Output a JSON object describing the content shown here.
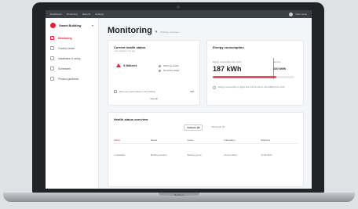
{
  "topbar": {
    "items": [
      "Dashboard",
      "Monitoring",
      "Reports",
      "Settings"
    ],
    "user_label": "User name"
  },
  "sidebar": {
    "brand_name": "Smart Building",
    "items": [
      {
        "label": "Monitoring",
        "active": true
      },
      {
        "label": "Control center",
        "active": false
      },
      {
        "label": "Installation & setup",
        "active": false
      },
      {
        "label": "Schedules",
        "active": false
      },
      {
        "label": "Product guidance",
        "active": false
      }
    ]
  },
  "main": {
    "title": "Monitoring",
    "title_sub": "Building overview",
    "health_card": {
      "title": "Current health status",
      "subtitle": "Last updated 5 min ago",
      "status": "3 failures",
      "legend": [
        "Warning states",
        "No active faults"
      ],
      "note": "Show only active failures in this building",
      "count": "3/28",
      "link": "View all"
    },
    "energy_card": {
      "title": "Energy consumption",
      "label": "Energy consumption this month",
      "value": "187 kWh",
      "limit_label": "Set limit",
      "limit_value": "140 kWh",
      "fill": 0.78,
      "note": "Energy consumption is higher than the limit set for this building this month"
    },
    "events_card": {
      "title": "Health status overview",
      "tabs": [
        "Failures (3)",
        "Warnings (5)"
      ],
      "columns": [
        "Status",
        "Device",
        "Group",
        "Information",
        "Date/time"
      ],
      "row": [
        "Unavailable",
        "Building actuator",
        "Building group",
        "Device offline",
        "14.04.2024"
      ]
    }
  },
  "laptop": {
    "label": "MacBook"
  },
  "colors": {
    "accent": "#e01f3d",
    "bar": "#e84d63"
  }
}
